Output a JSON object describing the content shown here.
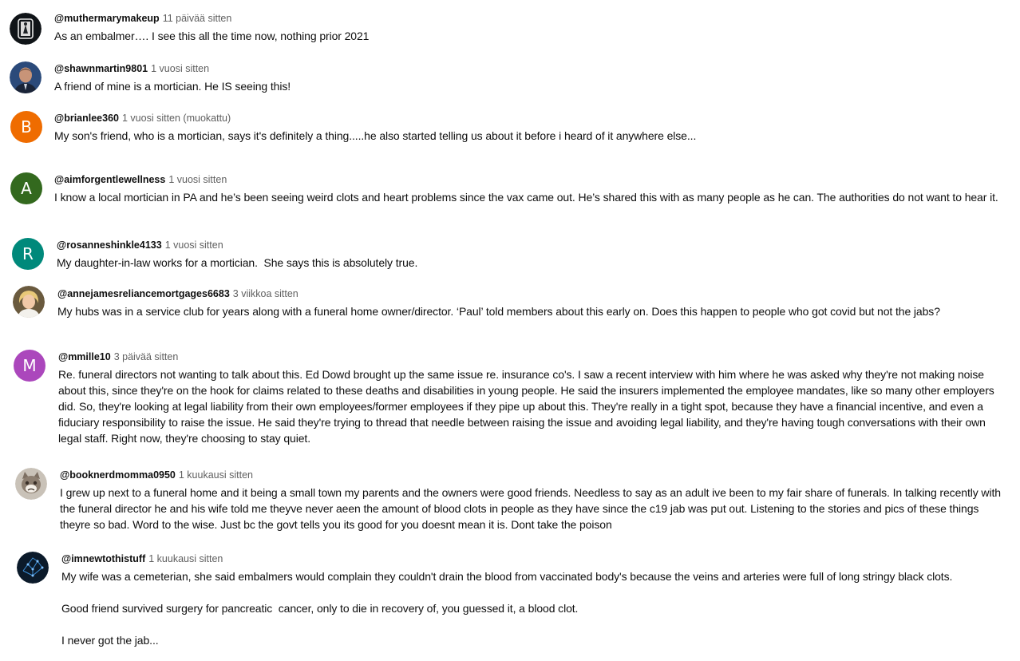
{
  "comments": [
    {
      "author": "@muthermarymakeup",
      "time": "11 päivää sitten",
      "text": "As an embalmer…. I see this all the time now, nothing prior 2021",
      "avatar": {
        "icon": "framed-portrait-icon",
        "color": "#101418"
      }
    },
    {
      "author": "@shawnmartin9801",
      "time": "1 vuosi sitten",
      "text": "A friend of mine is a mortician. He IS seeing this!",
      "avatar": {
        "icon": "profile-photo-icon",
        "color": "#2b4a7a"
      }
    },
    {
      "author": "@brianlee360",
      "time": "1 vuosi sitten (muokattu)",
      "text": "My son's friend, who is a mortician, says it's definitely a thing.....he also started telling us about it before i heard of it anywhere else...",
      "avatar": {
        "letter": "B",
        "color": "#ef6c00"
      }
    },
    {
      "author": "@aimforgentlewellness",
      "time": "1 vuosi sitten",
      "text": "I know a local mortician in PA and he’s been seeing weird clots and heart problems since the vax came out. He’s shared this with as many people as he can. The authorities do not want to hear it.",
      "avatar": {
        "letter": "A",
        "color": "#33691e"
      }
    },
    {
      "author": "@rosanneshinkle4133",
      "time": "1 vuosi sitten",
      "text": "My daughter-in-law works for a mortician.  She says this is absolutely true.",
      "avatar": {
        "letter": "R",
        "color": "#00897b"
      }
    },
    {
      "author": "@annejamesreliancemortgages6683",
      "time": "3 viikkoa sitten",
      "text": "My hubs was in a service club for years along with a funeral home owner/director. ‘Paul’ told members about this early on. Does this happen to people who got covid but not the jabs?",
      "avatar": {
        "icon": "profile-photo-icon",
        "color": "#d9b26a"
      }
    },
    {
      "author": "@mmille10",
      "time": "3 päivää sitten",
      "text": "Re. funeral directors not wanting to talk about this. Ed Dowd brought up the same issue re. insurance co's. I saw a recent interview with him where he was asked why they're not making noise about this, since they're on the hook for claims related to these deaths and disabilities in young people. He said the insurers implemented the employee mandates, like so many other employers did. So, they're looking at legal liability from their own employees/former employees if they pipe up about this. They're really in a tight spot, because they have a financial incentive, and even a fiduciary responsibility to raise the issue. He said they're trying to thread that needle between raising the issue and avoiding legal liability, and they're having tough conversations with their own legal staff. Right now, they're choosing to stay quiet.",
      "avatar": {
        "letter": "M",
        "color": "#ab47bc"
      }
    },
    {
      "author": "@booknerdmomma0950",
      "time": "1 kuukausi sitten",
      "text": "I grew up next to a funeral home and it being a small town my parents and the owners were good friends. Needless to say as an adult ive been to my fair share of funerals. In talking recently with the funeral director he and his wife told me theyve never aeen the amount of blood clots in people as they have since the c19 jab was put out. Listening to the stories and pics of these things theyre so bad. Word to the wise. Just bc the govt tells you its good for you doesnt mean it is. Dont take the poison",
      "avatar": {
        "icon": "cat-photo-icon",
        "color": "#9a8f86"
      }
    },
    {
      "author": "@imnewtothistuff",
      "time": "1 kuukausi sitten",
      "text": "My wife was a cemeterian, she said embalmers would complain they couldn't drain the blood from vaccinated body's because the veins and arteries were full of long stringy black clots.\n\nGood friend survived surgery for pancreatic  cancer, only to die in recovery of, you guessed it, a blood clot.\n\nI never got the jab...",
      "avatar": {
        "icon": "blue-network-icon",
        "color": "#0b1a2a"
      }
    }
  ]
}
